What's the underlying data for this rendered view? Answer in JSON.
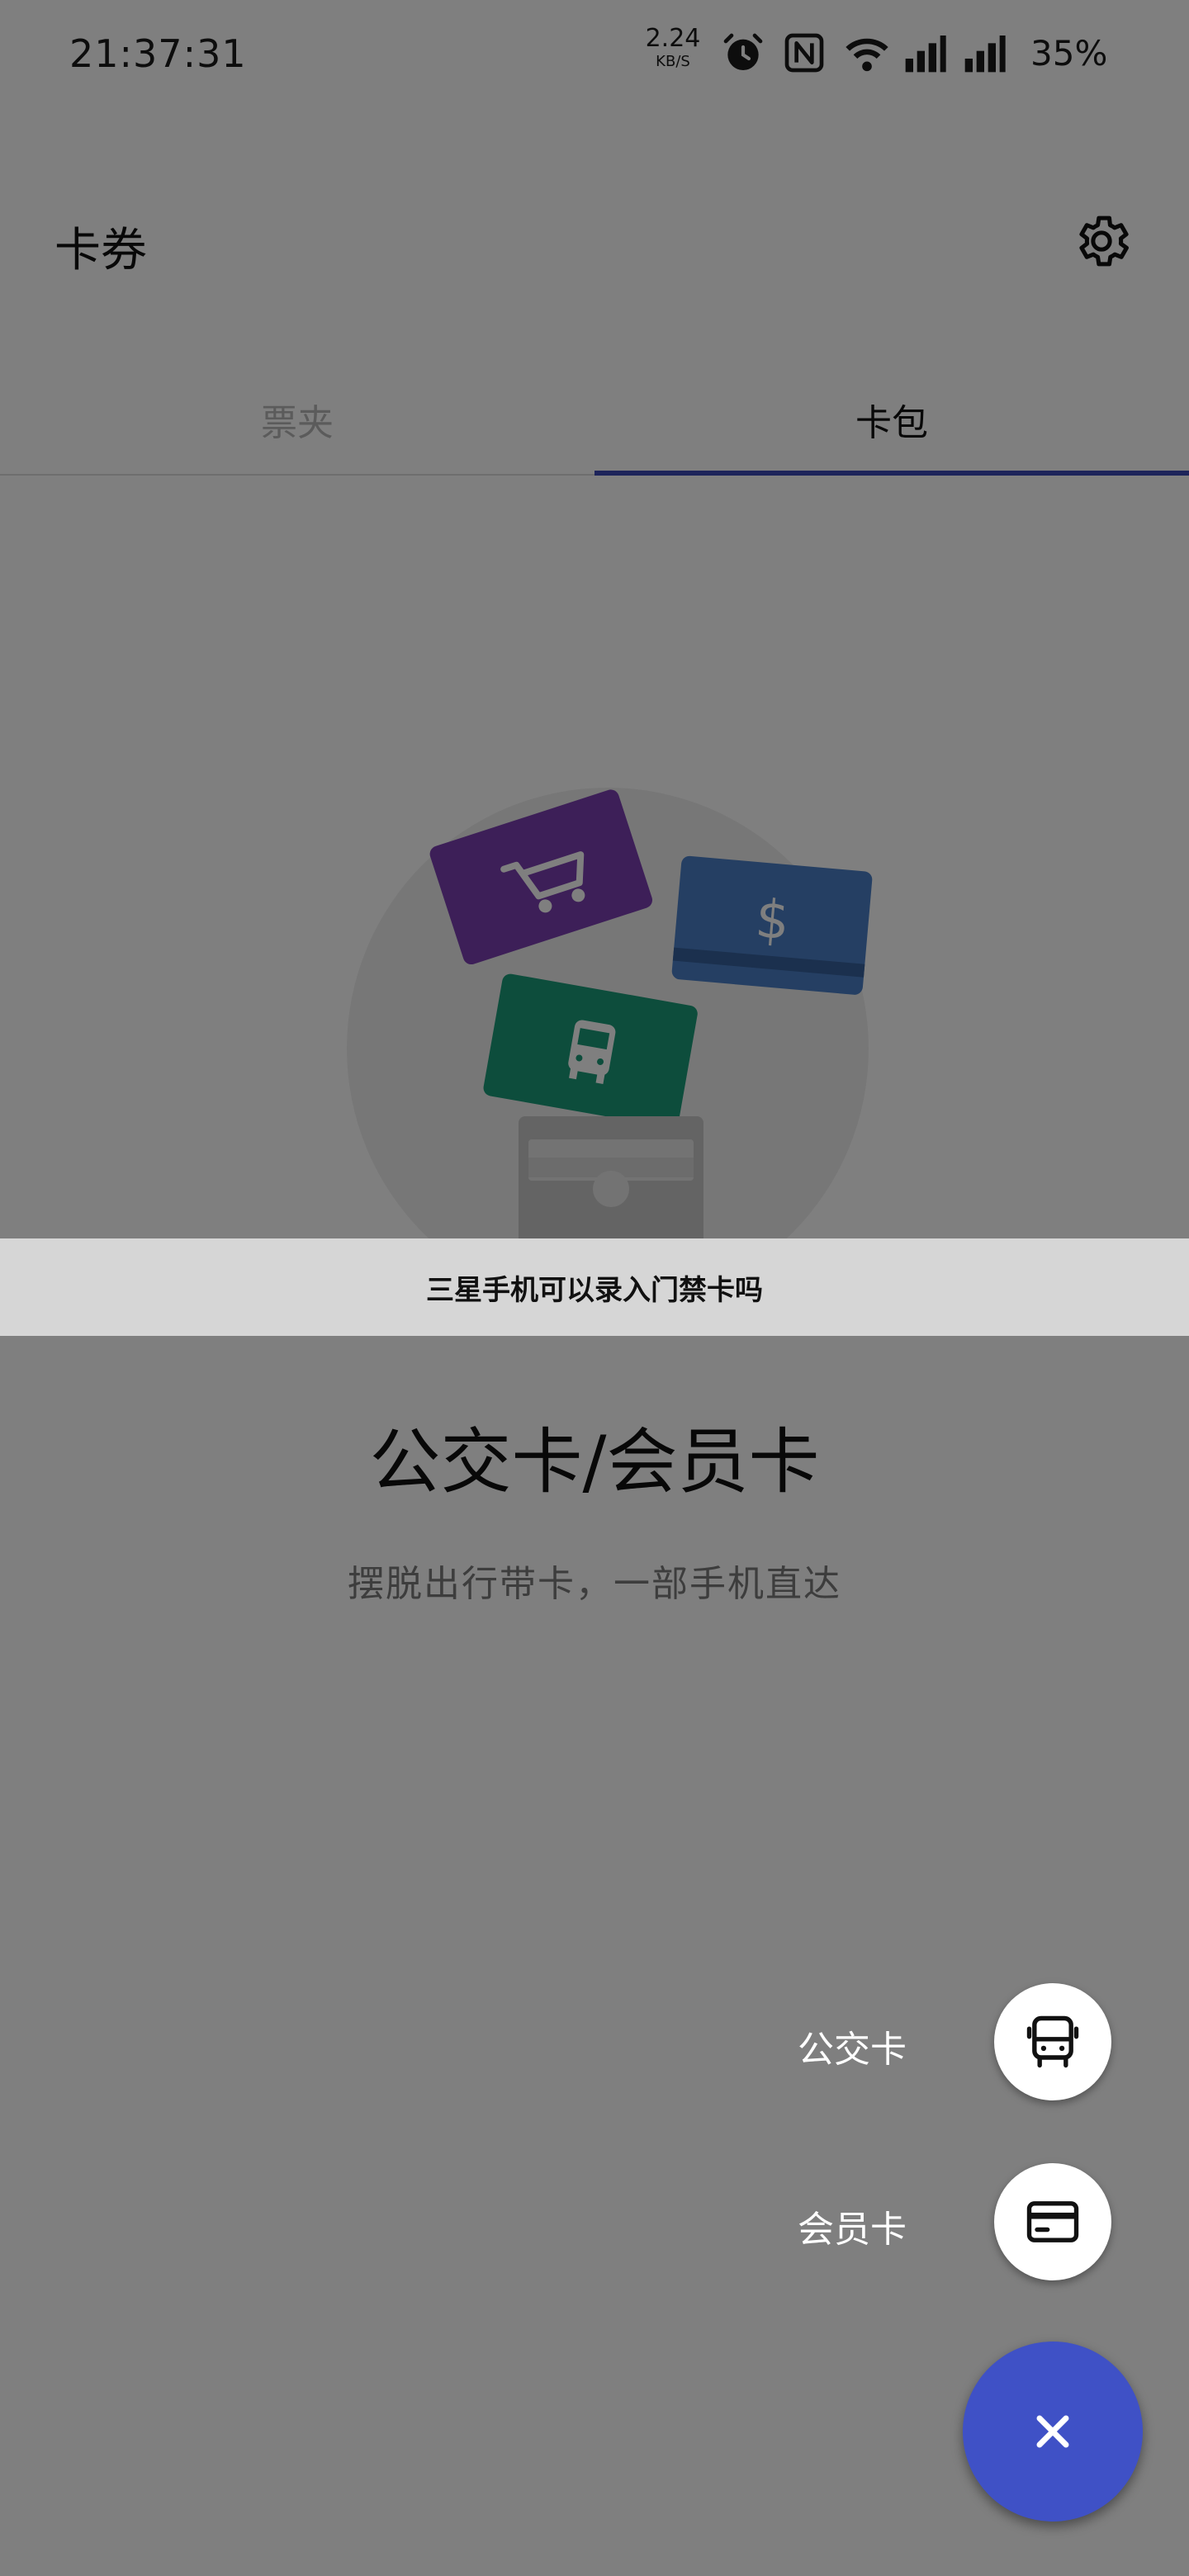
{
  "status_bar": {
    "time": "21:37:31",
    "net_speed_value": "2.24",
    "net_speed_unit": "KB/S",
    "battery": "35%",
    "icons": [
      "alarm-icon",
      "nfc-icon",
      "wifi-icon",
      "signal-icon",
      "signal-icon"
    ]
  },
  "header": {
    "title": "卡券",
    "settings_icon": "gear-icon"
  },
  "tabs": [
    {
      "label": "票夹",
      "selected": false
    },
    {
      "label": "卡包",
      "selected": true
    }
  ],
  "banner": {
    "text": "三星手机可以录入门禁卡吗"
  },
  "empty_state": {
    "title": "公交卡/会员卡",
    "subtitle": "摆脱出行带卡，一部手机直达"
  },
  "fab_menu": {
    "items": [
      {
        "label": "公交卡",
        "icon": "bus-icon"
      },
      {
        "label": "会员卡",
        "icon": "card-icon"
      }
    ],
    "close_icon": "close-icon"
  },
  "colors": {
    "accent": "#3b49b5",
    "fab": "#3f51c6",
    "card_purple": "#7b3fb0",
    "card_green": "#1b9a78",
    "card_blue": "#4a7fc6",
    "scrim": "rgba(0,0,0,0.5)"
  }
}
